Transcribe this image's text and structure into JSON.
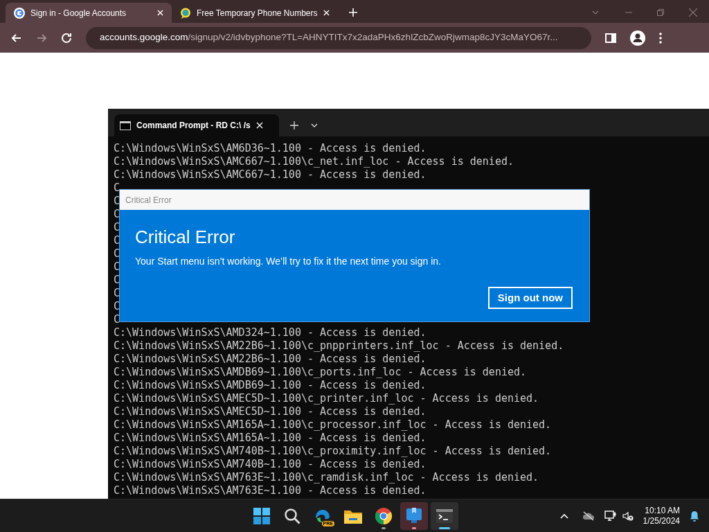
{
  "browser": {
    "tabs": [
      {
        "title": "Sign in - Google Accounts",
        "selected": true
      },
      {
        "title": "Free Temporary Phone Numbers",
        "selected": false
      }
    ],
    "address": {
      "host": "accounts.google.com",
      "path": "/signup/v2/idvbyphone?TL=AHNYTITx7x2adaPHx6zhlZcbZwoRjwmap8cJY3cMaYO67r..."
    }
  },
  "terminal": {
    "tab_title": "Command Prompt - RD  C:\\ /s",
    "lines": [
      "C:\\Windows\\WinSxS\\AM6D36~1.100 - Access is denied.",
      "C:\\Windows\\WinSxS\\AMC667~1.100\\c_net.inf_loc - Access is denied.",
      "C:\\Windows\\WinSxS\\AMC667~1.100 - Access is denied.",
      "C",
      "C",
      "C",
      "C",
      "C",
      "C",
      "C",
      "C",
      "C",
      "C",
      "C",
      "C:\\Windows\\WinSxS\\AMD324~1.100 - Access is denied.",
      "C:\\Windows\\WinSxS\\AM22B6~1.100\\c_pnpprinters.inf_loc - Access is denied.",
      "C:\\Windows\\WinSxS\\AM22B6~1.100 - Access is denied.",
      "C:\\Windows\\WinSxS\\AMDB69~1.100\\c_ports.inf_loc - Access is denied.",
      "C:\\Windows\\WinSxS\\AMDB69~1.100 - Access is denied.",
      "C:\\Windows\\WinSxS\\AMEC5D~1.100\\c_printer.inf_loc - Access is denied.",
      "C:\\Windows\\WinSxS\\AMEC5D~1.100 - Access is denied.",
      "C:\\Windows\\WinSxS\\AM165A~1.100\\c_processor.inf_loc - Access is denied.",
      "C:\\Windows\\WinSxS\\AM165A~1.100 - Access is denied.",
      "C:\\Windows\\WinSxS\\AM740B~1.100\\c_proximity.inf_loc - Access is denied.",
      "C:\\Windows\\WinSxS\\AM740B~1.100 - Access is denied.",
      "C:\\Windows\\WinSxS\\AM763E~1.100\\c_ramdisk.inf_loc - Access is denied.",
      "C:\\Windows\\WinSxS\\AM763E~1.100 - Access is denied."
    ]
  },
  "dialog": {
    "window_title": "Critical Error",
    "heading": "Critical Error",
    "message": "Your Start menu isn’t working. We’ll try to fix it the next time you sign in.",
    "button": "Sign out now"
  },
  "taskbar": {
    "apps": [
      {
        "kind": "start",
        "running": false,
        "attention": false,
        "selected": false
      },
      {
        "kind": "search",
        "running": false,
        "attention": false,
        "selected": false
      },
      {
        "kind": "edge",
        "badge": "PRE",
        "running": false,
        "attention": false,
        "selected": false
      },
      {
        "kind": "folder",
        "running": false,
        "attention": false,
        "selected": false
      },
      {
        "kind": "chrome",
        "running": true,
        "attention": false,
        "selected": false
      },
      {
        "kind": "app",
        "running": true,
        "attention": true,
        "selected": false
      },
      {
        "kind": "terminal",
        "running": true,
        "attention": false,
        "selected": true
      }
    ],
    "clock": {
      "time": "10:10 AM",
      "date": "1/25/2024"
    }
  }
}
